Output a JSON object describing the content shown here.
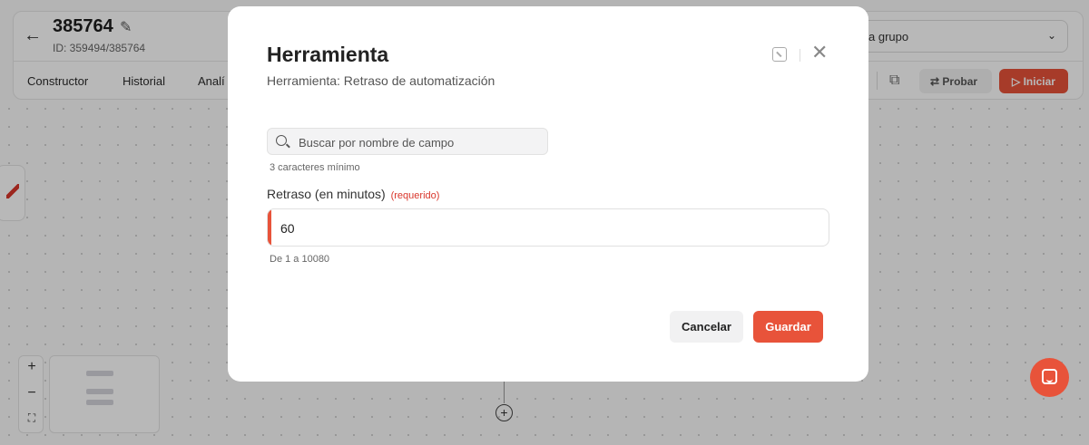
{
  "header": {
    "title": "385764",
    "id_text": "ID: 359494/385764",
    "group_select_value": "a grupo",
    "tabs": [
      {
        "label": "Constructor"
      },
      {
        "label": "Historial"
      },
      {
        "label": "Analí"
      }
    ],
    "probar_label": "Probar",
    "iniciar_label": "Iniciar"
  },
  "modal": {
    "title": "Herramienta",
    "subtitle": "Herramienta: Retraso de automatización",
    "search": {
      "placeholder": "Buscar por nombre de campo",
      "value": "",
      "hint": "3 caracteres mínimo"
    },
    "delay_field": {
      "label": "Retraso (en minutos)",
      "required_text": "(requerido)",
      "value": "60",
      "range_hint": "De 1 a 10080"
    },
    "cancel_label": "Cancelar",
    "save_label": "Guardar"
  },
  "colors": {
    "accent": "#e8533a",
    "required": "#d9362b"
  },
  "icons": {
    "back": "arrow-left-icon",
    "edit": "pencil-icon",
    "copy": "copy-icon",
    "probar": "swap-icon",
    "iniciar": "play-icon",
    "expand": "expand-icon",
    "close": "close-icon",
    "search": "search-icon",
    "zoom_in": "plus-icon",
    "zoom_out": "minus-icon",
    "fit": "fit-view-icon",
    "add_node": "add-circle-icon",
    "chat": "chat-icon"
  }
}
